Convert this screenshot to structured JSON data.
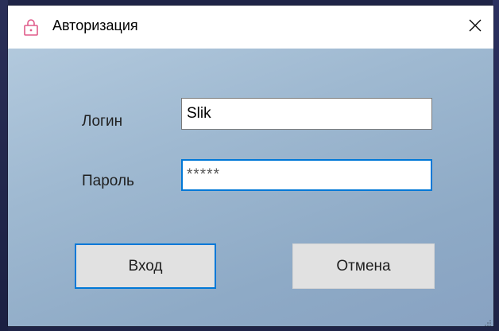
{
  "window": {
    "title": "Авторизация",
    "title_icon": "lock-icon",
    "close_icon": "close-icon"
  },
  "form": {
    "login_label": "Логин",
    "login_value": "Slik",
    "password_label": "Пароль",
    "password_value": "*****"
  },
  "buttons": {
    "login_label": "Вход",
    "cancel_label": "Отмена"
  },
  "colors": {
    "accent": "#0078d7",
    "button_bg": "#e1e1e1",
    "icon_pink": "#e05b8a"
  }
}
